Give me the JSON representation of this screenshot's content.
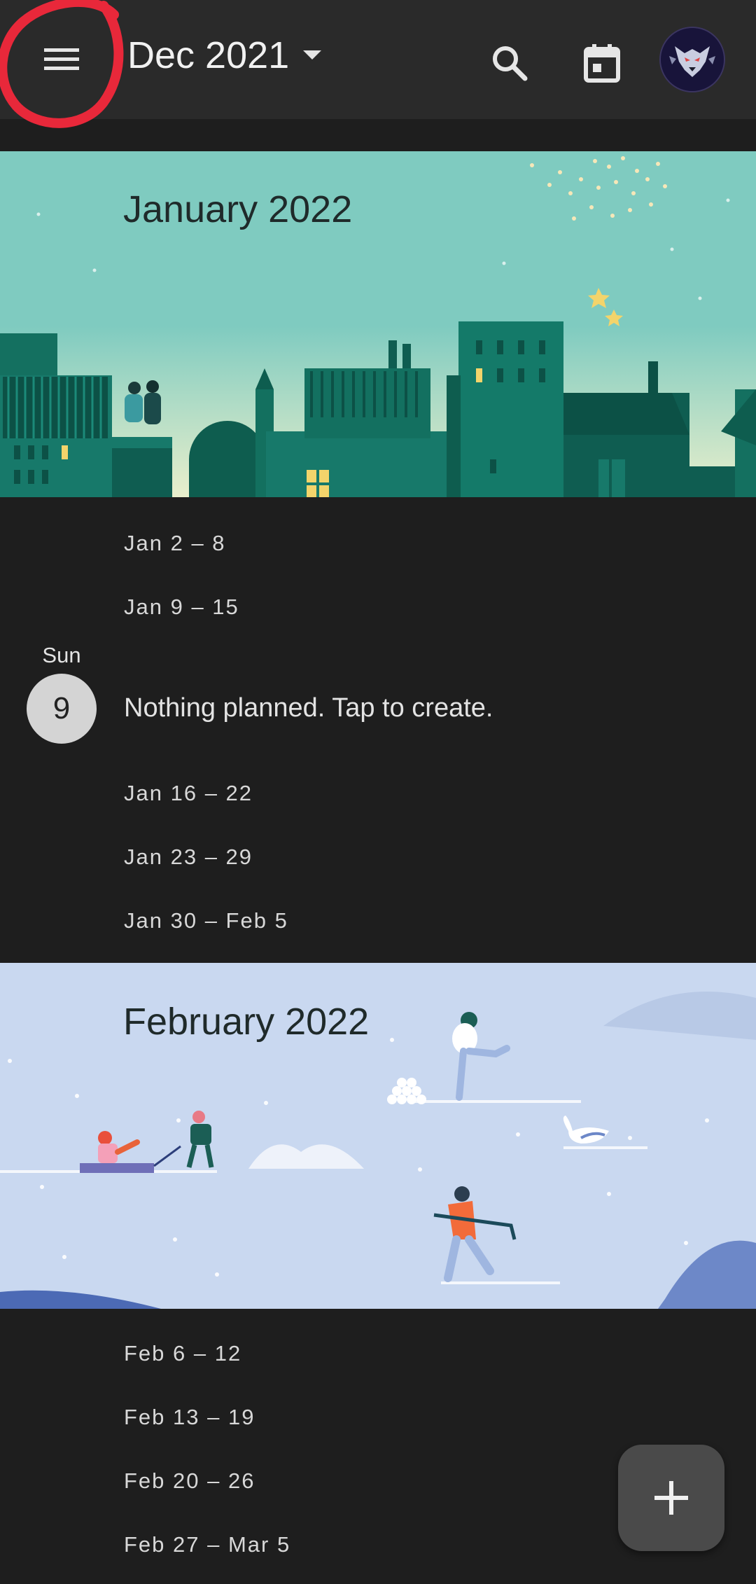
{
  "header": {
    "current_month": "Dec 2021",
    "menu_icon": "hamburger-menu-icon",
    "search_icon": "search-icon",
    "today_icon": "calendar-today-icon",
    "avatar_icon": "wolf-avatar-icon"
  },
  "months": [
    {
      "title": "January 2022",
      "weeks": [
        "Jan 2 – 8",
        "Jan 9 – 15",
        "Jan 16 – 22",
        "Jan 23 – 29",
        "Jan 30 – Feb 5"
      ]
    },
    {
      "title": "February 2022",
      "weeks": [
        "Feb 6 – 12",
        "Feb 13 – 19",
        "Feb 20 – 26",
        "Feb 27 – Mar 5"
      ]
    }
  ],
  "today": {
    "weekday": "Sun",
    "day": "9",
    "message": "Nothing planned. Tap to create."
  },
  "fab": {
    "icon": "plus-icon"
  },
  "colors": {
    "background": "#1e1e1e",
    "appbar": "#2a2a2a",
    "january_banner": "#7fcbc0",
    "february_banner": "#c9d8f0",
    "annotation": "#e8283a"
  }
}
